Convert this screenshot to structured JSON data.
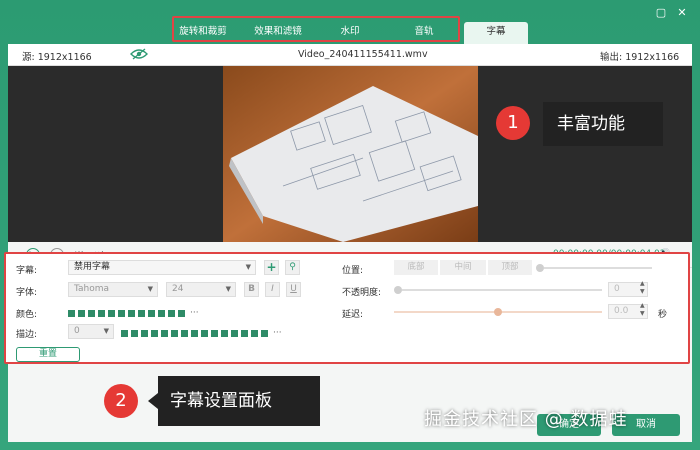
{
  "tabs": [
    "旋转和裁剪",
    "效果和滤镜",
    "水印",
    "音轨",
    "字幕"
  ],
  "info": {
    "source": "源: 1912x1166",
    "filename": "Video_240411155411.wmv",
    "output": "输出: 1912x1166"
  },
  "playback": {
    "time": "00:00:00.00/00:00:04.02",
    "progress": 0.0
  },
  "annotations": [
    {
      "number": "1",
      "text": "丰富功能"
    },
    {
      "number": "2",
      "text": "字幕设置面板"
    }
  ],
  "settings": {
    "subtitle_label": "字幕:",
    "subtitle_value": "禁用字幕",
    "font_label": "字体:",
    "font_value": "Tahoma",
    "font_size": "24",
    "bold": "B",
    "italic": "I",
    "underline": "U",
    "color_label": "颜色:",
    "outline_label": "描边:",
    "outline_value": "0",
    "position_label": "位置:",
    "position_options": [
      "底部",
      "中间",
      "顶部"
    ],
    "opacity_label": "不透明度:",
    "opacity_value": "0",
    "delay_label": "延迟:",
    "delay_value": "0.0",
    "delay_unit": "秒",
    "reset": "重置"
  },
  "buttons": {
    "ok": "确定",
    "cancel": "取消"
  },
  "watermark": "掘金技术社区 @ 数据蛙",
  "colors": {
    "accent": "#2e9a73",
    "highlight": "#e04444",
    "badge": "#e53935"
  }
}
